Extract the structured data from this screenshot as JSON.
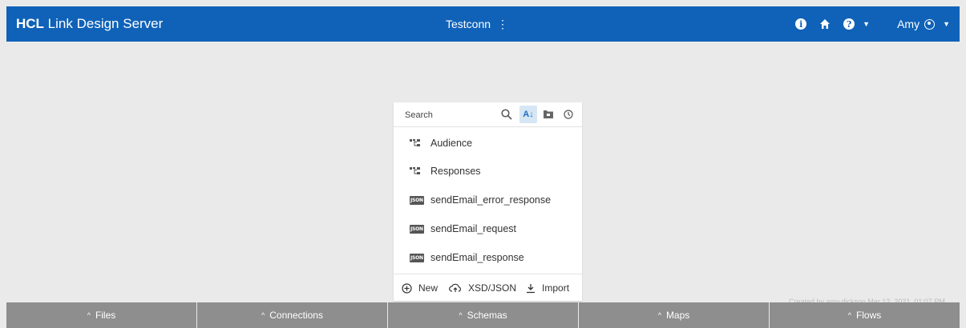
{
  "app": {
    "brand_bold": "HCL",
    "brand_rest": " Link Design Server"
  },
  "header": {
    "connection": "Testconn",
    "user": "Amy",
    "icons": [
      "info-icon",
      "home-icon",
      "help-icon",
      "user-avatar-icon"
    ]
  },
  "panel": {
    "search_placeholder": "Search",
    "tool_icons": [
      "search-icon",
      "sort-alpha-icon",
      "folder-icon",
      "history-icon"
    ],
    "items": [
      {
        "label": "Audience",
        "icon": "schema-tree-icon"
      },
      {
        "label": "Responses",
        "icon": "schema-tree-icon"
      },
      {
        "label": "sendEmail_error_response",
        "icon": "json-icon"
      },
      {
        "label": "sendEmail_request",
        "icon": "json-icon"
      },
      {
        "label": "sendEmail_response",
        "icon": "json-icon"
      }
    ],
    "json_badge": "JSON",
    "footer": {
      "new": "New",
      "xsd_json": "XSD/JSON",
      "import": "Import"
    }
  },
  "created_text": "Created by amy.dickson Mar 12, 2021, 01:07 PM",
  "tabs": [
    "Files",
    "Connections",
    "Schemas",
    "Maps",
    "Flows"
  ]
}
